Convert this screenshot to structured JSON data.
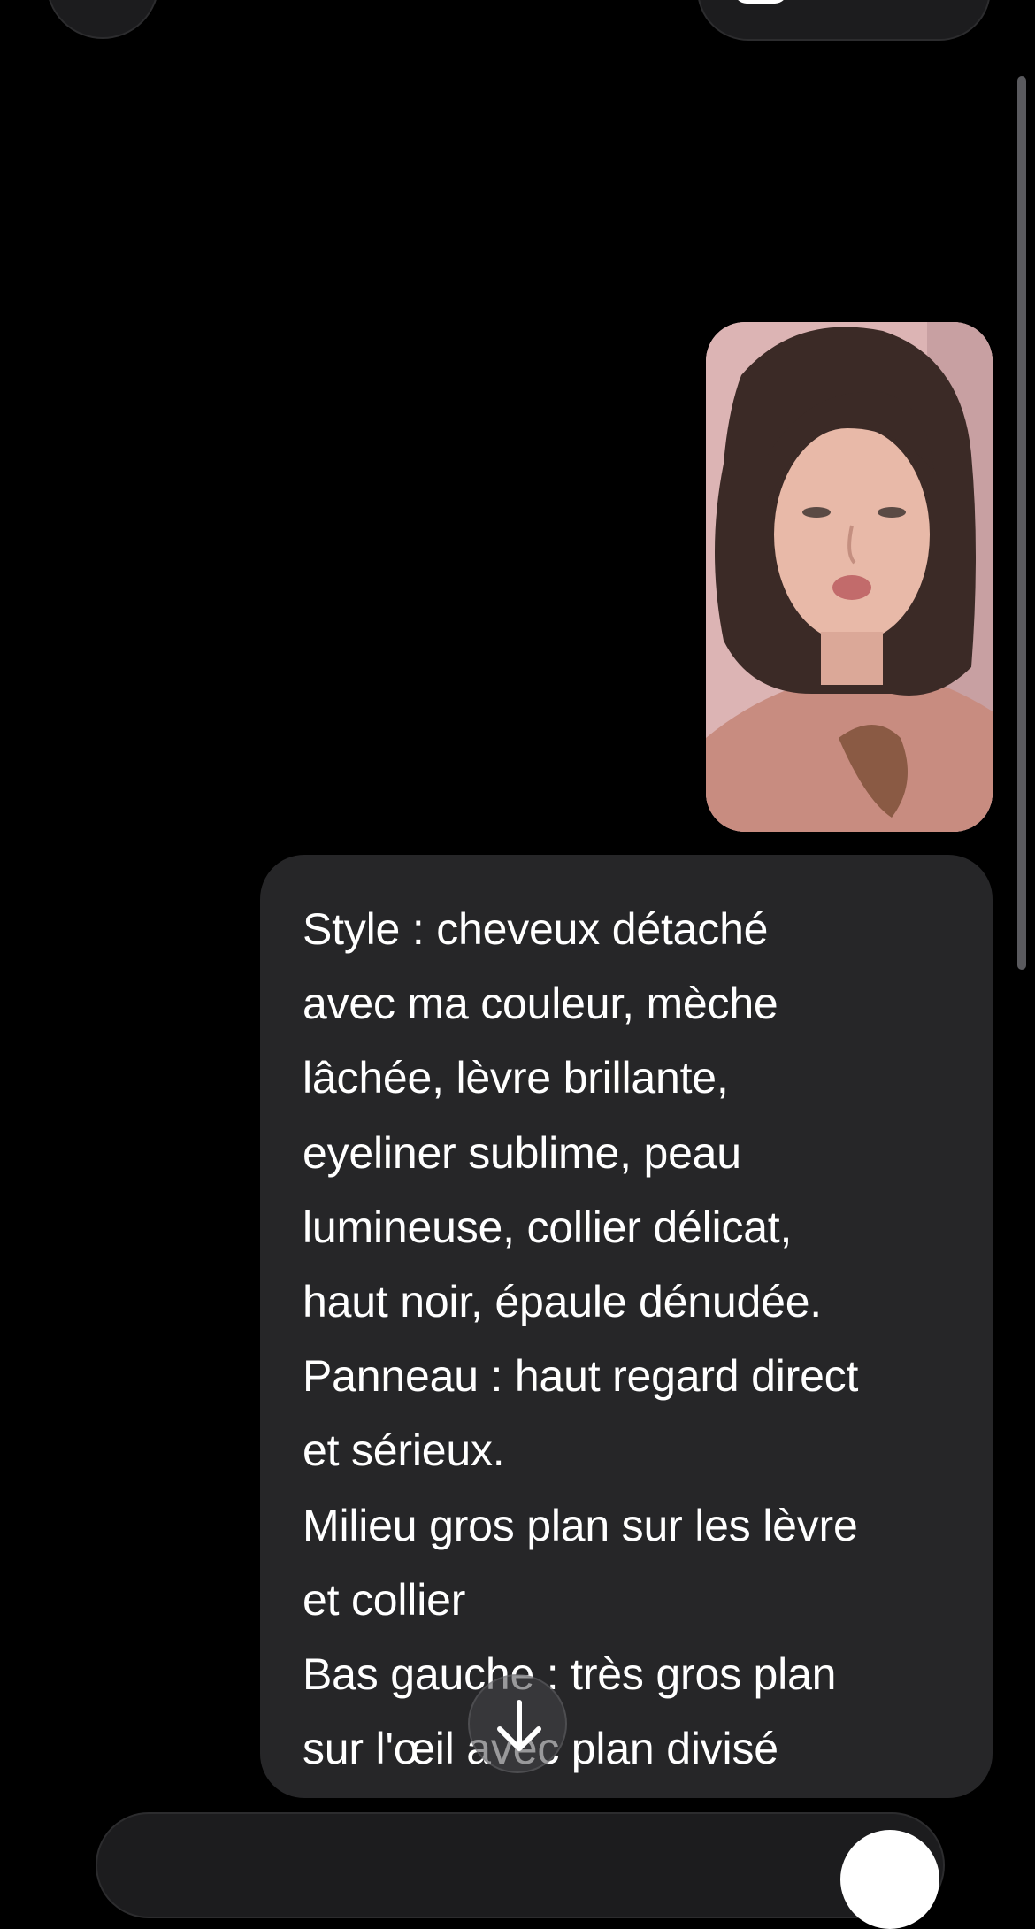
{
  "colors": {
    "background": "#000000",
    "bubble": "#262628",
    "text": "#ffffff",
    "control": "#1c1c1e"
  },
  "message": {
    "lines": [
      "Style : cheveux détaché",
      "avec ma couleur, mèche",
      "lâchée, lèvre brillante,",
      "eyeliner sublime, peau",
      "lumineuse, collier délicat,",
      "haut noir, épaule dénudée.",
      "Panneau : haut regard direct",
      "et sérieux.",
      "Milieu gros plan sur les lèvre",
      "et collier",
      "Bas gauche : très gros plan",
      "sur l'œil avec plan divisé"
    ]
  },
  "icons": {
    "scroll_down": "arrow-down-icon",
    "top_right": "share-icon"
  }
}
